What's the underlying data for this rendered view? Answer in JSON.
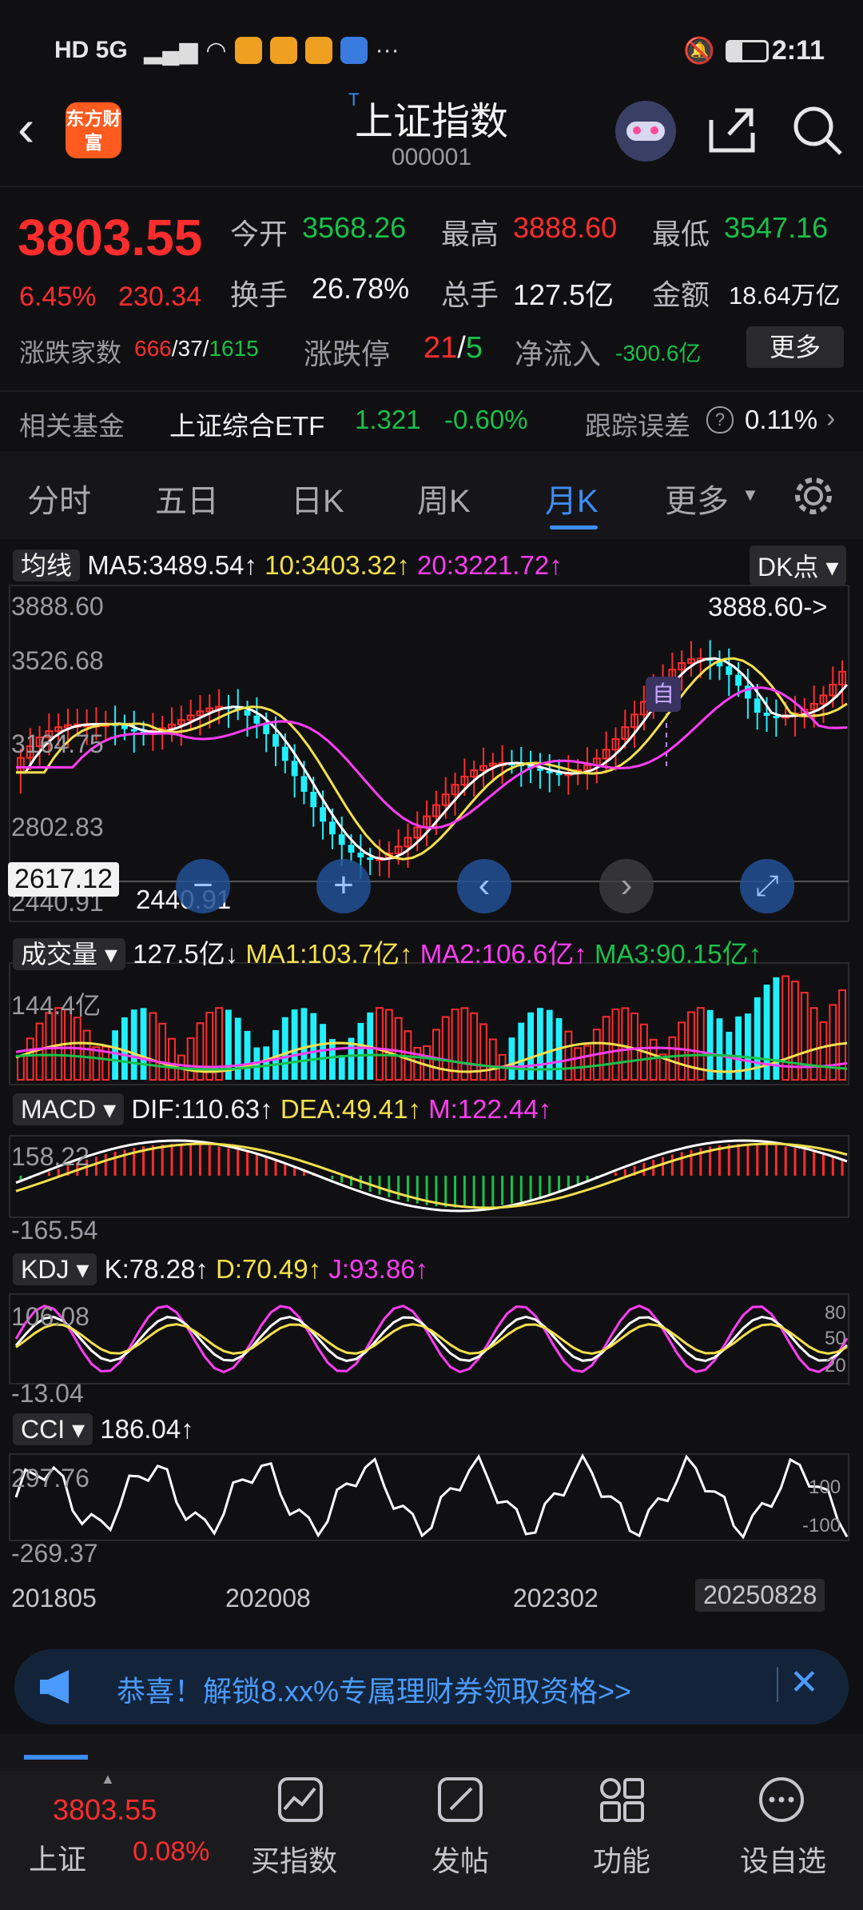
{
  "status_bar": {
    "left": "HD 5G",
    "time": "2:11"
  },
  "header": {
    "title": "上证指数",
    "code": "000001",
    "logo_text": "东方财富"
  },
  "quote": {
    "price": "3803.55",
    "change_pct": "6.45%",
    "change": "230.34",
    "open_label": "今开",
    "open": "3568.26",
    "high_label": "最高",
    "high": "3888.60",
    "low_label": "最低",
    "low": "3547.16",
    "turnover_label": "换手",
    "turnover": "26.78%",
    "volume_label": "总手",
    "volume": "127.5亿",
    "amount_label": "金额",
    "amount": "18.64万亿",
    "breadth_label": "涨跌家数",
    "breadth_up": "666",
    "breadth_flat": "37",
    "breadth_down": "1615",
    "limit_label": "涨跌停",
    "limit_up": "21",
    "limit_down": "5",
    "inflow_label": "净流入",
    "inflow": "-300.6亿",
    "more": "更多"
  },
  "fund": {
    "label": "相关基金",
    "name": "上证综合ETF",
    "price": "1.321",
    "change": "-0.60%",
    "err_label": "跟踪误差",
    "err": "0.11%"
  },
  "tabs": [
    "分时",
    "五日",
    "日K",
    "周K",
    "月K",
    "更多"
  ],
  "active_tab": "月K",
  "ma_row": {
    "chip": "均线",
    "ma5": "MA5:3489.54",
    "ma10": "10:3403.32",
    "ma20": "20:3221.72",
    "dk": "DK点"
  },
  "price_axis": {
    "top": "3888.60",
    "l2": "3526.68",
    "l3": "3164.75",
    "l4": "2802.83",
    "bottom": "2440.91",
    "high_marker": "3888.60->",
    "low_marker": "2440.91",
    "cursor": "2617.12",
    "tag": "自"
  },
  "vol_row": {
    "chip": "成交量",
    "vol": "127.5亿",
    "ma1": "MA1:103.7亿",
    "ma2": "MA2:106.6亿",
    "ma3": "MA3:90.15亿",
    "axis_top": "144.4亿"
  },
  "macd_row": {
    "chip": "MACD",
    "dif": "DIF:110.63",
    "dea": "DEA:49.41",
    "m": "M:122.44",
    "axis_top": "158.22",
    "axis_bottom": "-165.54"
  },
  "kdj_row": {
    "chip": "KDJ",
    "k": "K:78.28",
    "d": "D:70.49",
    "j": "J:93.86",
    "axis_top": "106.08",
    "axis_bottom": "-13.04",
    "r80": "80",
    "r50": "50",
    "r20": "20"
  },
  "cci_row": {
    "chip": "CCI",
    "cci": "186.04",
    "axis_top": "297.76",
    "axis_bottom": "-269.37",
    "r100": "100",
    "rm100": "-100"
  },
  "dates": [
    "201805",
    "202008",
    "202302",
    "20250828"
  ],
  "banner": {
    "text": "恭喜！解锁8.xx%专属理财券领取资格>>"
  },
  "nav": {
    "index_name": "上证",
    "index_price": "3803.55",
    "index_change": "0.08%",
    "items": [
      "买指数",
      "发帖",
      "功能",
      "设自选"
    ]
  },
  "colors": {
    "up": "#ff2d2d",
    "down": "#19c14a",
    "accent": "#3d8df5",
    "candle_down": "#21f0ff"
  }
}
